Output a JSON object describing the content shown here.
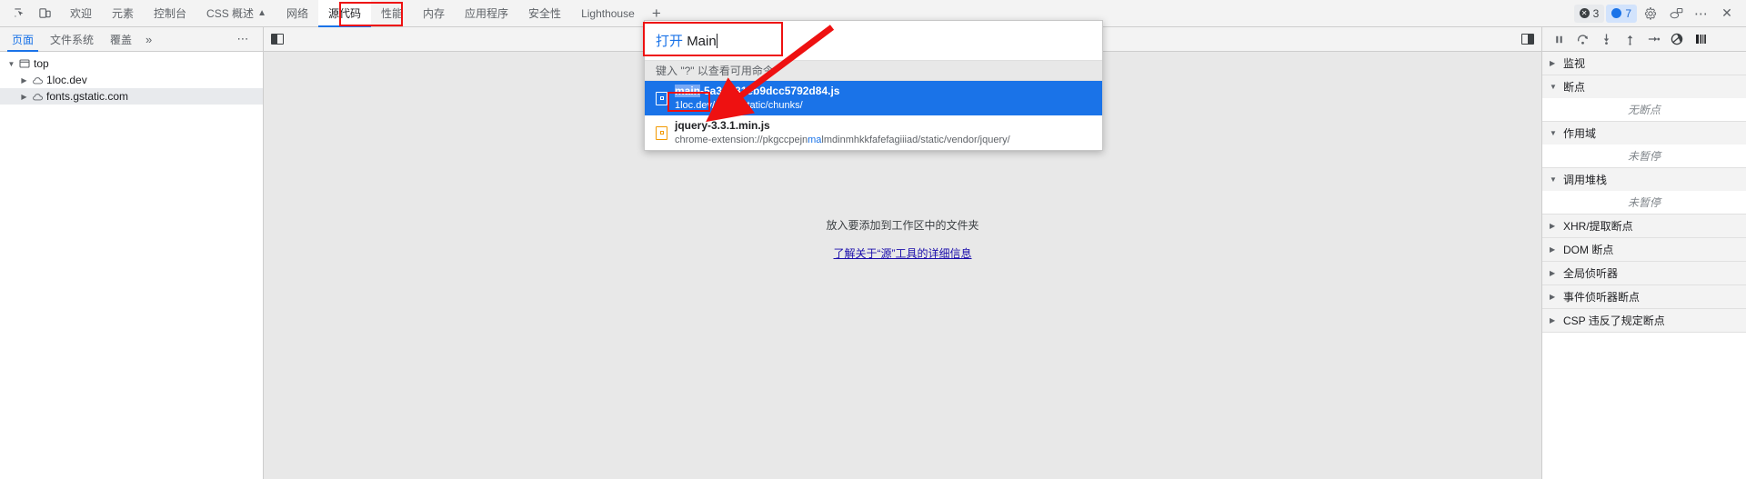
{
  "topbar": {
    "icons": [
      {
        "name": "inspect-element-icon",
        "glyph": "inspect"
      },
      {
        "name": "device-toolbar-icon",
        "glyph": "device"
      }
    ],
    "tabs": [
      {
        "label": "欢迎",
        "active": false
      },
      {
        "label": "元素",
        "active": false
      },
      {
        "label": "控制台",
        "active": false
      },
      {
        "label": "CSS 概述",
        "active": false,
        "warn": "▲"
      },
      {
        "label": "网络",
        "active": false
      },
      {
        "label": "源代码",
        "active": true
      },
      {
        "label": "性能",
        "active": false
      },
      {
        "label": "内存",
        "active": false
      },
      {
        "label": "应用程序",
        "active": false
      },
      {
        "label": "安全性",
        "active": false
      },
      {
        "label": "Lighthouse",
        "active": false
      }
    ],
    "add_tab_label": "+",
    "errors_count": "3",
    "issues_count": "7",
    "settings_label": "设置",
    "more_label": "⋯",
    "close_label": "✕"
  },
  "navigator": {
    "tabs": [
      {
        "label": "页面",
        "active": true
      },
      {
        "label": "文件系统",
        "active": false
      },
      {
        "label": "覆盖",
        "active": false
      }
    ],
    "more_tabs_label": "»",
    "options_label": "⋯",
    "tree": [
      {
        "label": "top",
        "indent": 0,
        "arrow": "▼",
        "icon": "frame-icon",
        "selected": false
      },
      {
        "label": "1loc.dev",
        "indent": 1,
        "arrow": "▶",
        "icon": "cloud-icon",
        "selected": false
      },
      {
        "label": "fonts.gstatic.com",
        "indent": 1,
        "arrow": "▶",
        "icon": "cloud-icon",
        "selected": true
      }
    ]
  },
  "editor": {
    "empty_text": "放入要添加到工作区中的文件夹",
    "empty_link": "了解关于“源”工具的详细信息"
  },
  "debugger": {
    "toolbar_icons": [
      {
        "name": "pause-script-icon"
      },
      {
        "name": "step-over-icon"
      },
      {
        "name": "step-into-icon"
      },
      {
        "name": "step-out-icon"
      },
      {
        "name": "step-icon"
      },
      {
        "name": "deactivate-breakpoints-icon"
      },
      {
        "name": "pause-on-exceptions-icon"
      }
    ],
    "sections": [
      {
        "title": "监视",
        "expanded": false,
        "body": null
      },
      {
        "title": "断点",
        "expanded": true,
        "body": "无断点"
      },
      {
        "title": "作用域",
        "expanded": true,
        "body": "未暂停"
      },
      {
        "title": "调用堆栈",
        "expanded": true,
        "body": "未暂停"
      },
      {
        "title": "XHR/提取断点",
        "expanded": false,
        "body": null
      },
      {
        "title": "DOM 断点",
        "expanded": false,
        "body": null
      },
      {
        "title": "全局侦听器",
        "expanded": false,
        "body": null
      },
      {
        "title": "事件侦听器断点",
        "expanded": false,
        "body": null
      },
      {
        "title": "CSP 违反了规定断点",
        "expanded": false,
        "body": null
      }
    ]
  },
  "command_menu": {
    "prefix": "打开",
    "query": "Main",
    "hint": "键入 \"?\" 以查看可用命令",
    "results": [
      {
        "match": "main",
        "title_rest": "-5a3d081eb9dcc5792d84.js",
        "subtitle": "1loc.dev/_next/static/chunks/",
        "selected": true
      },
      {
        "match": "",
        "title_rest": "jquery-3.3.1.min.js",
        "subtitle_pre": "chrome-extension://pkgccpejn",
        "subtitle_hl": "ma",
        "subtitle_post": "lmdinmhkkfafefagiiiad/static/vendor/jquery/",
        "selected": false
      }
    ]
  },
  "annotation": {
    "color": "#ee1111",
    "boxes": [
      "sources-tab-highlight",
      "open-main-input-highlight",
      "main-match-highlight"
    ],
    "arrow": "arrow-to-result"
  }
}
